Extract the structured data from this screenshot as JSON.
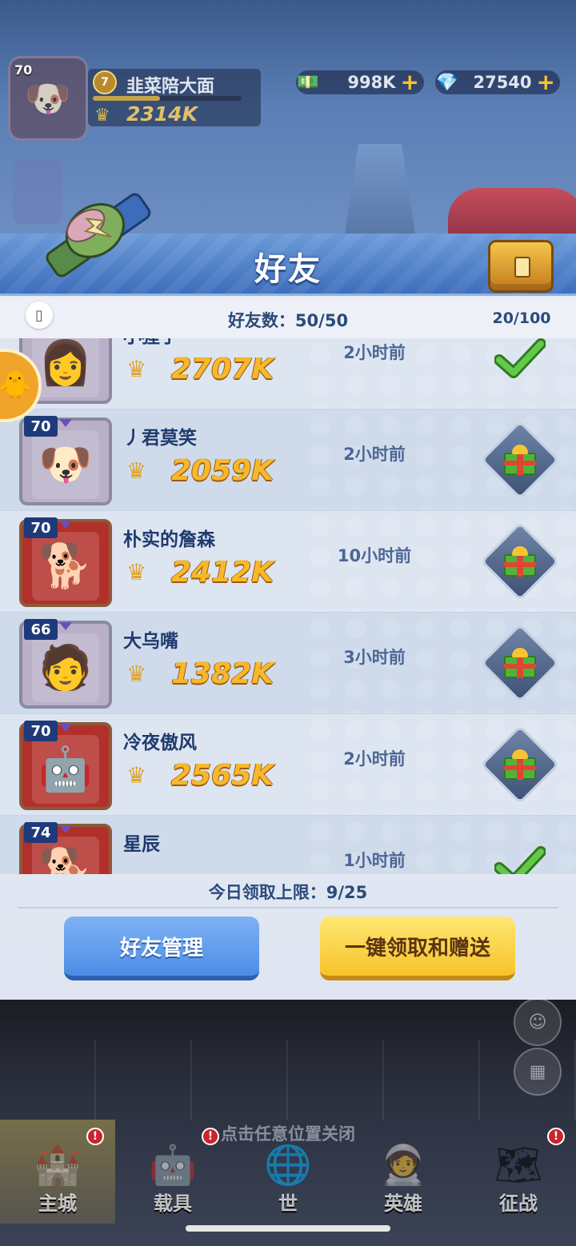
{
  "hud": {
    "level": "70",
    "rank": "7",
    "player_name": "韭菜陪大面",
    "power": "2314K",
    "xp_fraction": 0.45,
    "cash": "998K",
    "gems": "27540",
    "plus": "+"
  },
  "dialog": {
    "title": "好友",
    "friend_count_label": "好友数：50/50",
    "gift_count": "20/100",
    "daily_limit": "今日领取上限：9/25",
    "manage_button": "好友管理",
    "claim_send_button": "一键领取和赠送"
  },
  "friends": [
    {
      "level": "",
      "name": "小猩子",
      "power": "2707K",
      "time": "2小时前",
      "action": "check",
      "frame": "purple",
      "face": "👩"
    },
    {
      "level": "70",
      "name": "丿君莫笑",
      "power": "2059K",
      "time": "2小时前",
      "action": "gift",
      "frame": "purple",
      "face": "🐶"
    },
    {
      "level": "70",
      "name": "朴实的詹森",
      "power": "2412K",
      "time": "10小时前",
      "action": "gift",
      "frame": "red",
      "face": "🐕"
    },
    {
      "level": "66",
      "name": "大乌嘴",
      "power": "1382K",
      "time": "3小时前",
      "action": "gift",
      "frame": "purple",
      "face": "🧑"
    },
    {
      "level": "70",
      "name": "冷夜傲风",
      "power": "2565K",
      "time": "2小时前",
      "action": "gift",
      "frame": "red",
      "face": "🤖"
    },
    {
      "level": "74",
      "name": "星辰",
      "power": "",
      "time": "1小时前",
      "action": "check",
      "frame": "red",
      "face": "🐕"
    }
  ],
  "overlay": {
    "close_hint": "点击任意位置关闭"
  },
  "nav": [
    {
      "label": "主城",
      "icon": "castle-icon",
      "badge": "!"
    },
    {
      "label": "载具",
      "icon": "vehicle-icon",
      "badge": "!"
    },
    {
      "label": "世",
      "icon": "world-icon",
      "badge": ""
    },
    {
      "label": "英雄",
      "icon": "hero-icon",
      "badge": ""
    },
    {
      "label": "征战",
      "icon": "battle-icon",
      "badge": "!"
    }
  ],
  "colors": {
    "header_blue": "#4f80c8",
    "gold_text": "#f8b82a",
    "manage_btn": "#4d8ce6",
    "claim_btn": "#f6c328"
  }
}
